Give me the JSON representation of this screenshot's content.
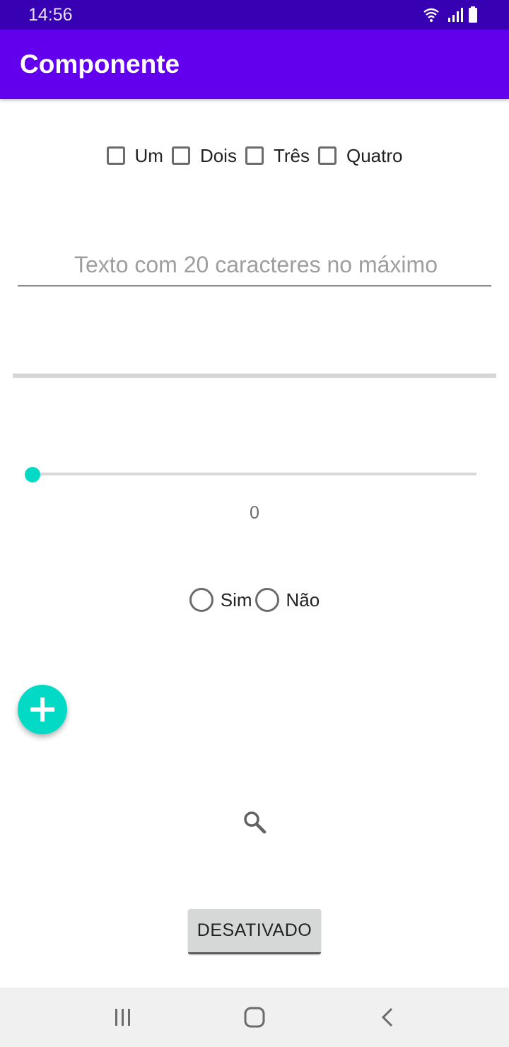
{
  "status_bar": {
    "time": "14:56",
    "icons": [
      "wifi-icon",
      "signal-icon",
      "battery-icon"
    ]
  },
  "app_bar": {
    "title": "Componente"
  },
  "checkboxes": [
    {
      "label": "Um",
      "checked": false
    },
    {
      "label": "Dois",
      "checked": false
    },
    {
      "label": "Três",
      "checked": false
    },
    {
      "label": "Quatro",
      "checked": false
    }
  ],
  "text_field": {
    "value": "",
    "placeholder": "Texto com 20 caracteres no máximo"
  },
  "progress": {
    "value": 0
  },
  "seekbar": {
    "value": 0,
    "value_label": "0"
  },
  "radios": [
    {
      "label": "Sim",
      "selected": false
    },
    {
      "label": "Não",
      "selected": false
    }
  ],
  "fab": {
    "icon": "plus-icon"
  },
  "search_button": {
    "icon": "search-icon"
  },
  "disabled_button": {
    "label": "DESATIVADO"
  },
  "nav_bar": {
    "icons": [
      "recents-icon",
      "home-icon",
      "back-icon"
    ]
  },
  "colors": {
    "primary": "#6200ee",
    "primary_dark": "#3700b3",
    "accent": "#03dac5"
  }
}
